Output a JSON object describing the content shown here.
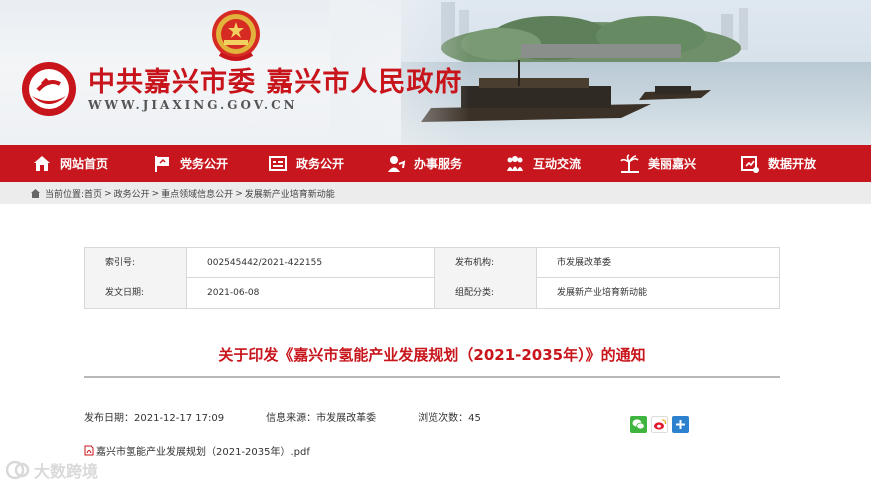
{
  "header": {
    "site_title": "中共嘉兴市委 嘉兴市人民政府",
    "site_url": "WWW.JIAXING.GOV.CN"
  },
  "nav": {
    "items": [
      {
        "label": "网站首页",
        "icon": "home-icon"
      },
      {
        "label": "党务公开",
        "icon": "party-flag-icon"
      },
      {
        "label": "政务公开",
        "icon": "gov-open-icon"
      },
      {
        "label": "办事服务",
        "icon": "service-icon"
      },
      {
        "label": "互动交流",
        "icon": "interaction-icon"
      },
      {
        "label": "美丽嘉兴",
        "icon": "scenery-icon"
      },
      {
        "label": "数据开放",
        "icon": "data-open-icon"
      }
    ]
  },
  "breadcrumb": {
    "prefix": "当前位置:",
    "items": [
      "首页",
      "政务公开",
      "重点领域信息公开",
      "发展新产业培育新动能"
    ],
    "separator": ">"
  },
  "info": {
    "index_label": "索引号:",
    "index_value": "002545442/2021-422155",
    "publisher_label": "发布机构:",
    "publisher_value": "市发展改革委",
    "date_label": "发文日期:",
    "date_value": "2021-06-08",
    "category_label": "组配分类:",
    "category_value": "发展新产业培育新动能"
  },
  "article": {
    "title": "关于印发《嘉兴市氢能产业发展规划（2021-2035年）》的通知",
    "publish_date_label": "发布日期：",
    "publish_date": "2021-12-17 17:09",
    "source_label": "信息来源：",
    "source": "市发展改革委",
    "views_label": "浏览次数：",
    "views": "45",
    "attachment": "嘉兴市氢能产业发展规划（2021-2035年）.pdf"
  },
  "share": {
    "buttons": [
      "wechat-icon",
      "weibo-icon",
      "more-share-icon"
    ]
  },
  "watermark": {
    "text": "大数跨境"
  },
  "colors": {
    "brand_red": "#c7161d",
    "title_red": "#c8141b",
    "crumb_bg": "#ececec"
  }
}
